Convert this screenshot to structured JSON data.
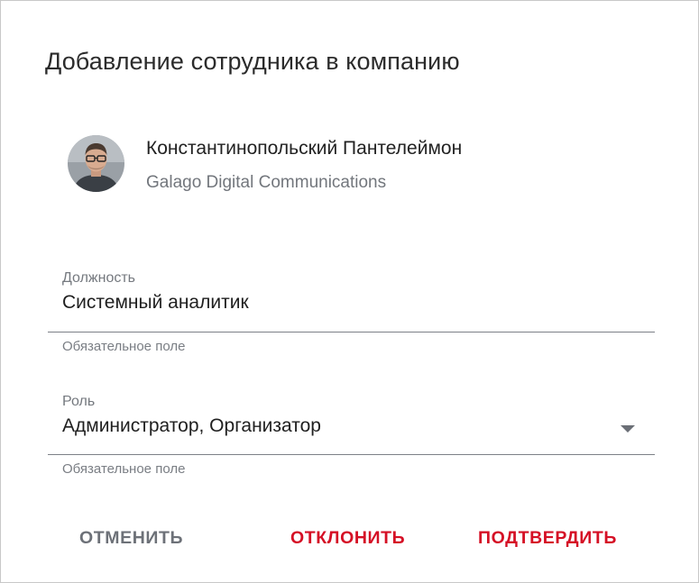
{
  "dialog": {
    "title": "Добавление сотрудника в компанию"
  },
  "user": {
    "name": "Константинопольский Пантелеймон",
    "company": "Galago Digital Communications",
    "avatar_icon": "user-photo"
  },
  "fields": {
    "position": {
      "label": "Должность",
      "value": "Системный аналитик",
      "hint": "Обязательное поле"
    },
    "role": {
      "label": "Роль",
      "value": "Администратор, Организатор",
      "hint": "Обязательное поле",
      "icon": "dropdown-arrow-icon"
    }
  },
  "actions": {
    "cancel_label": "ОТМЕНИТЬ",
    "reject_label": "ОТКЛОНИТЬ",
    "confirm_label": "ПОДТВЕРДИТЬ"
  },
  "colors": {
    "accent": "#d50f25",
    "muted": "#6d7178"
  }
}
